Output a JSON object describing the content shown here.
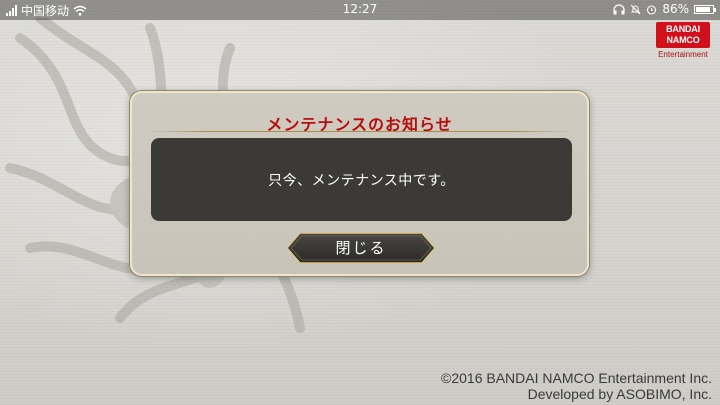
{
  "status_bar": {
    "carrier": "中国移动",
    "time": "12:27",
    "battery_percent": "86%",
    "battery_level": 0.86,
    "icons": [
      "signal-icon",
      "wifi-icon",
      "headphones-icon",
      "mute-bell-icon",
      "alarm-icon",
      "battery-icon"
    ]
  },
  "logo": {
    "mark_text": "BANDAI NAMCO",
    "sub_text": "Entertainment"
  },
  "dialog": {
    "title": "メンテナンスのお知らせ",
    "message": "只今、メンテナンス中です。",
    "close_label": "閉じる"
  },
  "footer": {
    "copyright_line1": "©2016 BANDAI NAMCO Entertainment Inc.",
    "copyright_line2": "Developed by ASOBIMO, Inc."
  },
  "colors": {
    "title_red": "#b80c0c",
    "message_panel": "#3b3a37",
    "logo_red": "#d0101b"
  }
}
